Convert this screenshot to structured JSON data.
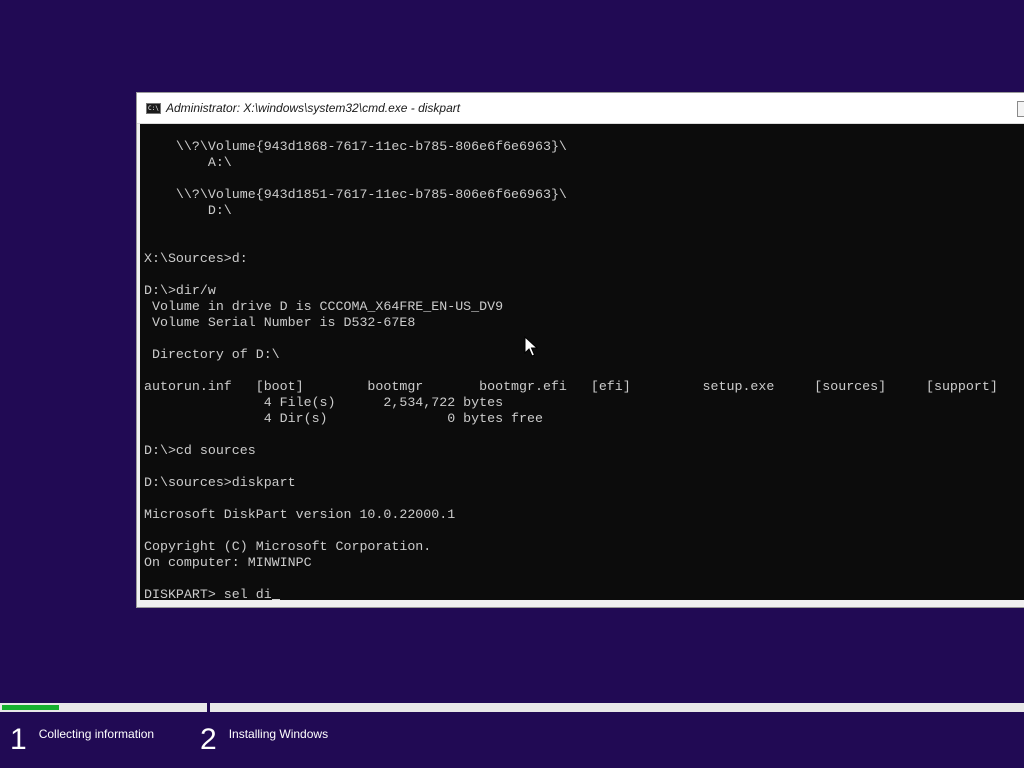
{
  "window": {
    "title": "Administrator: X:\\windows\\system32\\cmd.exe - diskpart",
    "icon": "cmd-icon",
    "icon_text": "C:\\"
  },
  "console": {
    "lines": [
      "    \\\\?\\Volume{943d1868-7617-11ec-b785-806e6f6e6963}\\",
      "        A:\\",
      "",
      "    \\\\?\\Volume{943d1851-7617-11ec-b785-806e6f6e6963}\\",
      "        D:\\",
      "",
      "",
      "X:\\Sources>d:",
      "",
      "D:\\>dir/w",
      " Volume in drive D is CCCOMA_X64FRE_EN-US_DV9",
      " Volume Serial Number is D532-67E8",
      "",
      " Directory of D:\\",
      "",
      "autorun.inf   [boot]        bootmgr       bootmgr.efi   [efi]         setup.exe     [sources]     [support]",
      "               4 File(s)      2,534,722 bytes",
      "               4 Dir(s)               0 bytes free",
      "",
      "D:\\>cd sources",
      "",
      "D:\\sources>diskpart",
      "",
      "Microsoft DiskPart version 10.0.22000.1",
      "",
      "Copyright (C) Microsoft Corporation.",
      "On computer: MINWINPC",
      ""
    ],
    "prompt": "DISKPART> ",
    "input": "sel di"
  },
  "setup": {
    "progress": 0.28,
    "accent_color": "#16b02f",
    "background_color": "#210a54",
    "steps": [
      {
        "number": "1",
        "label": "Collecting information"
      },
      {
        "number": "2",
        "label": "Installing Windows"
      }
    ]
  }
}
